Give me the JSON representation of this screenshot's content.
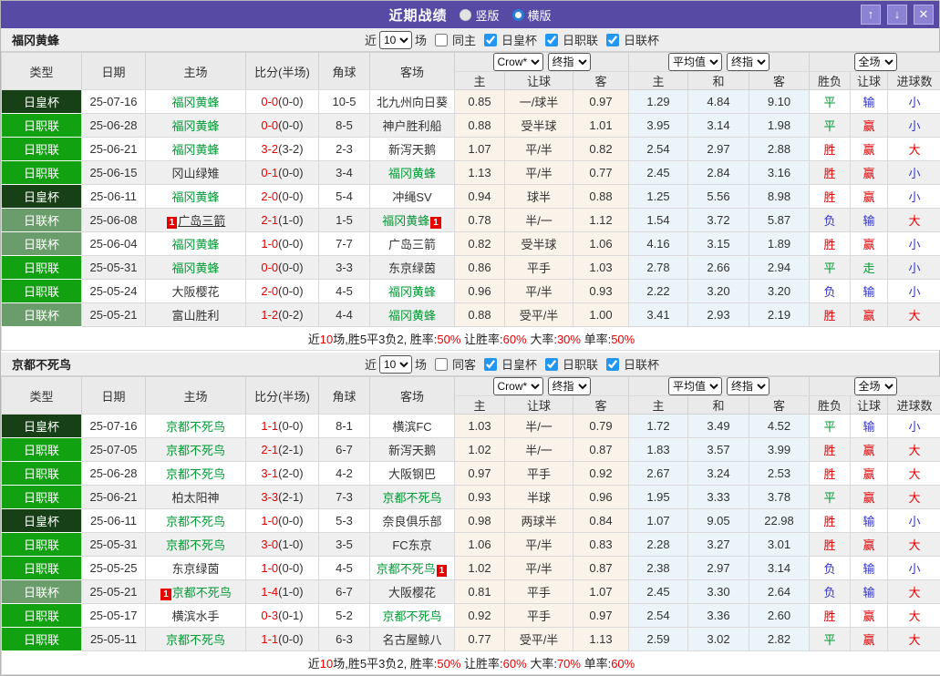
{
  "titlebar": {
    "title": "近期战绩",
    "radio_vertical": "竖版",
    "radio_horizontal": "横版",
    "up_button": "↑",
    "down_button": "↓",
    "close_button": "✕"
  },
  "cols": {
    "type": "类型",
    "date": "日期",
    "home": "主场",
    "score": "比分(半场)",
    "corner": "角球",
    "away": "客场",
    "odds_source": "Crow*",
    "odds_time1": "终指",
    "avg_source": "平均值",
    "odds_time2": "终指",
    "scope": "全场",
    "h1": "主",
    "handicap": "让球",
    "a1": "客",
    "h2": "主",
    "draw": "和",
    "a2": "客",
    "wdl": "胜负",
    "handicap_result": "让球",
    "goals": "进球数"
  },
  "colors": {
    "accent_purple": "#574aa5",
    "cup_emperor": "#174017",
    "league_j1": "#11a111",
    "league_cup": "#6b9c6b",
    "win_red": "#e60000",
    "draw_green": "#009933",
    "lose_blue": "#3333cc",
    "check_blue": "#2196f3"
  },
  "tables": [
    {
      "team": "福冈黄蜂",
      "filter": {
        "near": "近",
        "count": "10",
        "chang": "场",
        "same": "同主",
        "cup1": "日皇杯",
        "cup2": "日职联",
        "cup3": "日联杯"
      },
      "rows": [
        {
          "lg": "日皇杯",
          "lc": "e",
          "date": "25-07-16",
          "h": "福冈黄蜂",
          "hs": true,
          "hp": "",
          "hu": false,
          "sc": "0-0",
          "hf": "(0-0)",
          "cr": "10-5",
          "a": "北九州向日葵",
          "as": false,
          "ap": "",
          "o1": "0.85",
          "o2": "一/球半",
          "o3": "0.97",
          "a1": "1.29",
          "a2": "4.84",
          "a3": "9.10",
          "r1": "平",
          "c1": "g",
          "r2": "输",
          "c2": "b",
          "r3": "小",
          "c3": "b"
        },
        {
          "lg": "日职联",
          "lc": "j",
          "date": "25-06-28",
          "h": "福冈黄蜂",
          "hs": true,
          "hp": "",
          "hu": false,
          "sc": "0-0",
          "hf": "(0-0)",
          "cr": "8-5",
          "a": "神户胜利船",
          "as": false,
          "ap": "",
          "o1": "0.88",
          "o2": "受半球",
          "o3": "1.01",
          "a1": "3.95",
          "a2": "3.14",
          "a3": "1.98",
          "r1": "平",
          "c1": "g",
          "r2": "赢",
          "c2": "r",
          "r3": "小",
          "c3": "b"
        },
        {
          "lg": "日职联",
          "lc": "j",
          "date": "25-06-21",
          "h": "福冈黄蜂",
          "hs": true,
          "hp": "",
          "hu": false,
          "sc": "3-2",
          "hf": "(3-2)",
          "cr": "2-3",
          "a": "新泻天鹅",
          "as": false,
          "ap": "",
          "o1": "1.07",
          "o2": "平/半",
          "o3": "0.82",
          "a1": "2.54",
          "a2": "2.97",
          "a3": "2.88",
          "r1": "胜",
          "c1": "r",
          "r2": "赢",
          "c2": "r",
          "r3": "大",
          "c3": "r"
        },
        {
          "lg": "日职联",
          "lc": "j",
          "date": "25-06-15",
          "h": "冈山绿雉",
          "hs": false,
          "hp": "",
          "hu": false,
          "sc": "0-1",
          "hf": "(0-0)",
          "cr": "3-4",
          "a": "福冈黄蜂",
          "as": true,
          "ap": "",
          "o1": "1.13",
          "o2": "平/半",
          "o3": "0.77",
          "a1": "2.45",
          "a2": "2.84",
          "a3": "3.16",
          "r1": "胜",
          "c1": "r",
          "r2": "赢",
          "c2": "r",
          "r3": "小",
          "c3": "b"
        },
        {
          "lg": "日皇杯",
          "lc": "e",
          "date": "25-06-11",
          "h": "福冈黄蜂",
          "hs": true,
          "hp": "",
          "hu": false,
          "sc": "2-0",
          "hf": "(0-0)",
          "cr": "5-4",
          "a": "冲绳SV",
          "as": false,
          "ap": "",
          "o1": "0.94",
          "o2": "球半",
          "o3": "0.88",
          "a1": "1.25",
          "a2": "5.56",
          "a3": "8.98",
          "r1": "胜",
          "c1": "r",
          "r2": "赢",
          "c2": "r",
          "r3": "小",
          "c3": "b"
        },
        {
          "lg": "日联杯",
          "lc": "l",
          "date": "25-06-08",
          "h": "广岛三箭",
          "hs": false,
          "hp": "1",
          "hu": true,
          "sc": "2-1",
          "hf": "(1-0)",
          "cr": "1-5",
          "a": "福冈黄蜂",
          "as": true,
          "ap": "1",
          "o1": "0.78",
          "o2": "半/一",
          "o3": "1.12",
          "a1": "1.54",
          "a2": "3.72",
          "a3": "5.87",
          "r1": "负",
          "c1": "b",
          "r2": "输",
          "c2": "b",
          "r3": "大",
          "c3": "r"
        },
        {
          "lg": "日联杯",
          "lc": "l",
          "date": "25-06-04",
          "h": "福冈黄蜂",
          "hs": true,
          "hp": "",
          "hu": false,
          "sc": "1-0",
          "hf": "(0-0)",
          "cr": "7-7",
          "a": "广岛三箭",
          "as": false,
          "ap": "",
          "o1": "0.82",
          "o2": "受半球",
          "o3": "1.06",
          "a1": "4.16",
          "a2": "3.15",
          "a3": "1.89",
          "r1": "胜",
          "c1": "r",
          "r2": "赢",
          "c2": "r",
          "r3": "小",
          "c3": "b"
        },
        {
          "lg": "日职联",
          "lc": "j",
          "date": "25-05-31",
          "h": "福冈黄蜂",
          "hs": true,
          "hp": "",
          "hu": false,
          "sc": "0-0",
          "hf": "(0-0)",
          "cr": "3-3",
          "a": "东京绿茵",
          "as": false,
          "ap": "",
          "o1": "0.86",
          "o2": "平手",
          "o3": "1.03",
          "a1": "2.78",
          "a2": "2.66",
          "a3": "2.94",
          "r1": "平",
          "c1": "g",
          "r2": "走",
          "c2": "g",
          "r3": "小",
          "c3": "b"
        },
        {
          "lg": "日职联",
          "lc": "j",
          "date": "25-05-24",
          "h": "大阪樱花",
          "hs": false,
          "hp": "",
          "hu": false,
          "sc": "2-0",
          "hf": "(0-0)",
          "cr": "4-5",
          "a": "福冈黄蜂",
          "as": true,
          "ap": "",
          "o1": "0.96",
          "o2": "平/半",
          "o3": "0.93",
          "a1": "2.22",
          "a2": "3.20",
          "a3": "3.20",
          "r1": "负",
          "c1": "b",
          "r2": "输",
          "c2": "b",
          "r3": "小",
          "c3": "b"
        },
        {
          "lg": "日联杯",
          "lc": "l",
          "date": "25-05-21",
          "h": "富山胜利",
          "hs": false,
          "hp": "",
          "hu": false,
          "sc": "1-2",
          "hf": "(0-2)",
          "cr": "4-4",
          "a": "福冈黄蜂",
          "as": true,
          "ap": "",
          "o1": "0.88",
          "o2": "受平/半",
          "o3": "1.00",
          "a1": "3.41",
          "a2": "2.93",
          "a3": "2.19",
          "r1": "胜",
          "c1": "r",
          "r2": "赢",
          "c2": "r",
          "r3": "大",
          "c3": "r"
        }
      ],
      "summary": [
        "近",
        "10",
        "场,胜5平3负2, 胜率:",
        "50%",
        " 让胜率:",
        "60%",
        " 大率:",
        "30%",
        " 单率:",
        "50%"
      ]
    },
    {
      "team": "京都不死鸟",
      "filter": {
        "near": "近",
        "count": "10",
        "chang": "场",
        "same": "同客",
        "cup1": "日皇杯",
        "cup2": "日职联",
        "cup3": "日联杯"
      },
      "rows": [
        {
          "lg": "日皇杯",
          "lc": "e",
          "date": "25-07-16",
          "h": "京都不死鸟",
          "hs": true,
          "hp": "",
          "hu": false,
          "sc": "1-1",
          "hf": "(0-0)",
          "cr": "8-1",
          "a": "横滨FC",
          "as": false,
          "ap": "",
          "o1": "1.03",
          "o2": "半/一",
          "o3": "0.79",
          "a1": "1.72",
          "a2": "3.49",
          "a3": "4.52",
          "r1": "平",
          "c1": "g",
          "r2": "输",
          "c2": "b",
          "r3": "小",
          "c3": "b"
        },
        {
          "lg": "日职联",
          "lc": "j",
          "date": "25-07-05",
          "h": "京都不死鸟",
          "hs": true,
          "hp": "",
          "hu": false,
          "sc": "2-1",
          "hf": "(2-1)",
          "cr": "6-7",
          "a": "新泻天鹅",
          "as": false,
          "ap": "",
          "o1": "1.02",
          "o2": "半/一",
          "o3": "0.87",
          "a1": "1.83",
          "a2": "3.57",
          "a3": "3.99",
          "r1": "胜",
          "c1": "r",
          "r2": "赢",
          "c2": "r",
          "r3": "大",
          "c3": "r"
        },
        {
          "lg": "日职联",
          "lc": "j",
          "date": "25-06-28",
          "h": "京都不死鸟",
          "hs": true,
          "hp": "",
          "hu": false,
          "sc": "3-1",
          "hf": "(2-0)",
          "cr": "4-2",
          "a": "大阪钢巴",
          "as": false,
          "ap": "",
          "o1": "0.97",
          "o2": "平手",
          "o3": "0.92",
          "a1": "2.67",
          "a2": "3.24",
          "a3": "2.53",
          "r1": "胜",
          "c1": "r",
          "r2": "赢",
          "c2": "r",
          "r3": "大",
          "c3": "r"
        },
        {
          "lg": "日职联",
          "lc": "j",
          "date": "25-06-21",
          "h": "柏太阳神",
          "hs": false,
          "hp": "",
          "hu": false,
          "sc": "3-3",
          "hf": "(2-1)",
          "cr": "7-3",
          "a": "京都不死鸟",
          "as": true,
          "ap": "",
          "o1": "0.93",
          "o2": "半球",
          "o3": "0.96",
          "a1": "1.95",
          "a2": "3.33",
          "a3": "3.78",
          "r1": "平",
          "c1": "g",
          "r2": "赢",
          "c2": "r",
          "r3": "大",
          "c3": "r"
        },
        {
          "lg": "日皇杯",
          "lc": "e",
          "date": "25-06-11",
          "h": "京都不死鸟",
          "hs": true,
          "hp": "",
          "hu": false,
          "sc": "1-0",
          "hf": "(0-0)",
          "cr": "5-3",
          "a": "奈良俱乐部",
          "as": false,
          "ap": "",
          "o1": "0.98",
          "o2": "两球半",
          "o3": "0.84",
          "a1": "1.07",
          "a2": "9.05",
          "a3": "22.98",
          "r1": "胜",
          "c1": "r",
          "r2": "输",
          "c2": "b",
          "r3": "小",
          "c3": "b"
        },
        {
          "lg": "日职联",
          "lc": "j",
          "date": "25-05-31",
          "h": "京都不死鸟",
          "hs": true,
          "hp": "",
          "hu": false,
          "sc": "3-0",
          "hf": "(1-0)",
          "cr": "3-5",
          "a": "FC东京",
          "as": false,
          "ap": "",
          "o1": "1.06",
          "o2": "平/半",
          "o3": "0.83",
          "a1": "2.28",
          "a2": "3.27",
          "a3": "3.01",
          "r1": "胜",
          "c1": "r",
          "r2": "赢",
          "c2": "r",
          "r3": "大",
          "c3": "r"
        },
        {
          "lg": "日职联",
          "lc": "j",
          "date": "25-05-25",
          "h": "东京绿茵",
          "hs": false,
          "hp": "",
          "hu": false,
          "sc": "1-0",
          "hf": "(0-0)",
          "cr": "4-5",
          "a": "京都不死鸟",
          "as": true,
          "ap": "1",
          "o1": "1.02",
          "o2": "平/半",
          "o3": "0.87",
          "a1": "2.38",
          "a2": "2.97",
          "a3": "3.14",
          "r1": "负",
          "c1": "b",
          "r2": "输",
          "c2": "b",
          "r3": "小",
          "c3": "b"
        },
        {
          "lg": "日联杯",
          "lc": "l",
          "date": "25-05-21",
          "h": "京都不死鸟",
          "hs": true,
          "hp": "1",
          "hu": false,
          "sc": "1-4",
          "hf": "(1-0)",
          "cr": "6-7",
          "a": "大阪樱花",
          "as": false,
          "ap": "",
          "o1": "0.81",
          "o2": "平手",
          "o3": "1.07",
          "a1": "2.45",
          "a2": "3.30",
          "a3": "2.64",
          "r1": "负",
          "c1": "b",
          "r2": "输",
          "c2": "b",
          "r3": "大",
          "c3": "r"
        },
        {
          "lg": "日职联",
          "lc": "j",
          "date": "25-05-17",
          "h": "横滨水手",
          "hs": false,
          "hp": "",
          "hu": false,
          "sc": "0-3",
          "hf": "(0-1)",
          "cr": "5-2",
          "a": "京都不死鸟",
          "as": true,
          "ap": "",
          "o1": "0.92",
          "o2": "平手",
          "o3": "0.97",
          "a1": "2.54",
          "a2": "3.36",
          "a3": "2.60",
          "r1": "胜",
          "c1": "r",
          "r2": "赢",
          "c2": "r",
          "r3": "大",
          "c3": "r"
        },
        {
          "lg": "日职联",
          "lc": "j",
          "date": "25-05-11",
          "h": "京都不死鸟",
          "hs": true,
          "hp": "",
          "hu": false,
          "sc": "1-1",
          "hf": "(0-0)",
          "cr": "6-3",
          "a": "名古屋鲸八",
          "as": false,
          "ap": "",
          "o1": "0.77",
          "o2": "受平/半",
          "o3": "1.13",
          "a1": "2.59",
          "a2": "3.02",
          "a3": "2.82",
          "r1": "平",
          "c1": "g",
          "r2": "赢",
          "c2": "r",
          "r3": "大",
          "c3": "r"
        }
      ],
      "summary": [
        "近",
        "10",
        "场,胜5平3负2, 胜率:",
        "50%",
        " 让胜率:",
        "60%",
        " 大率:",
        "70%",
        " 单率:",
        "60%"
      ]
    }
  ]
}
